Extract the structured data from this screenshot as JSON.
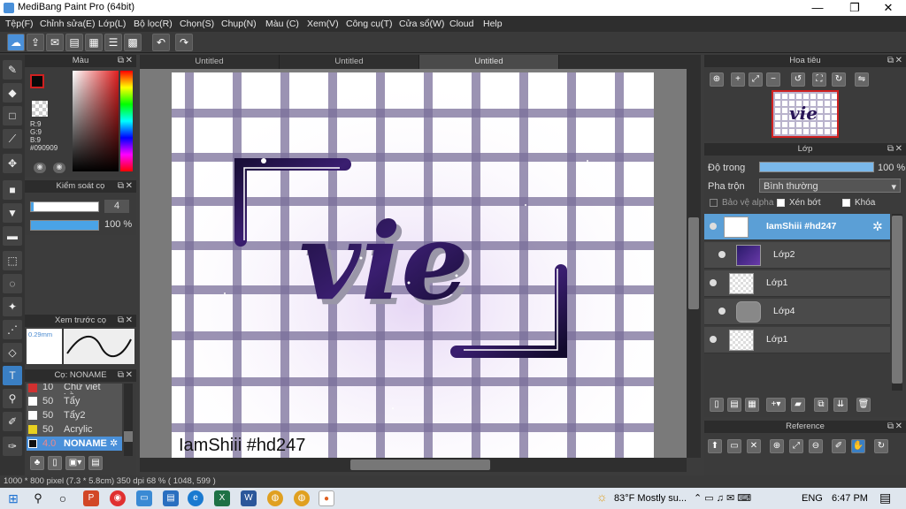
{
  "window": {
    "title": "MediBang Paint Pro (64bit)",
    "minimize": "—",
    "restore": "❐",
    "close": "✕"
  },
  "menu": [
    "Tệp(F)",
    "Chỉnh sửa(E)",
    "Lớp(L)",
    "Bộ lọc(R)",
    "Chọn(S)",
    "Chụp(N)",
    "Màu (C)",
    "Xem(V)",
    "Công cụ(T)",
    "Cửa sổ(W)",
    "Cloud",
    "Help"
  ],
  "tabs": [
    "Untitled",
    "Untitled",
    "Untitled"
  ],
  "color_panel": {
    "title": "Màu",
    "r": "R:9",
    "g": "G:9",
    "b": "B:9",
    "hex": "#090909"
  },
  "brush_control": {
    "title": "Kiểm soát cọ",
    "size": "4",
    "opacity": "100 %"
  },
  "brush_preview": {
    "title": "Xem trước cọ",
    "size_label": "0.29mm"
  },
  "brush_list": {
    "title": "Cọ: NONAME",
    "items": [
      {
        "size": "10",
        "name": "Chữ viết bằng",
        "color": "#d03030"
      },
      {
        "size": "50",
        "name": "Tẩy",
        "color": "#ffffff"
      },
      {
        "size": "50",
        "name": "Tẩy2",
        "color": "#ffffff"
      },
      {
        "size": "50",
        "name": "Acrylic",
        "color": "#e8d020"
      },
      {
        "size": "4.0",
        "name": "NONAME",
        "color": "#111111"
      }
    ]
  },
  "canvas": {
    "signature": "IamShiii #hd247",
    "artwork_text": "vie"
  },
  "navigator": {
    "title": "Hoa tiêu",
    "thumb_text": "vie"
  },
  "layers": {
    "title": "Lớp",
    "opacity_label": "Độ trong",
    "opacity_value": "100 %",
    "opacity_level": 1.0,
    "blend_label": "Pha trộn",
    "blend_value": "Bình thường",
    "protect_alpha": "Bảo vệ alpha",
    "clipping": "Xén bớt",
    "lock": "Khóa",
    "items": [
      {
        "name": "IamShiii #hd247",
        "selected": true
      },
      {
        "name": "Lớp2",
        "selected": false
      },
      {
        "name": "Lớp1",
        "selected": false
      },
      {
        "name": "Lớp4",
        "selected": false
      },
      {
        "name": "Lớp1",
        "selected": false
      }
    ]
  },
  "reference": {
    "title": "Reference"
  },
  "status": {
    "text": "1000 * 800 pixel  (7.3 * 5.8cm)  350 dpi  68 %  ( 1048, 599 )"
  },
  "taskbar": {
    "weather": "83°F  Mostly su...",
    "lang": "ENG",
    "time": "6:47 PM"
  }
}
